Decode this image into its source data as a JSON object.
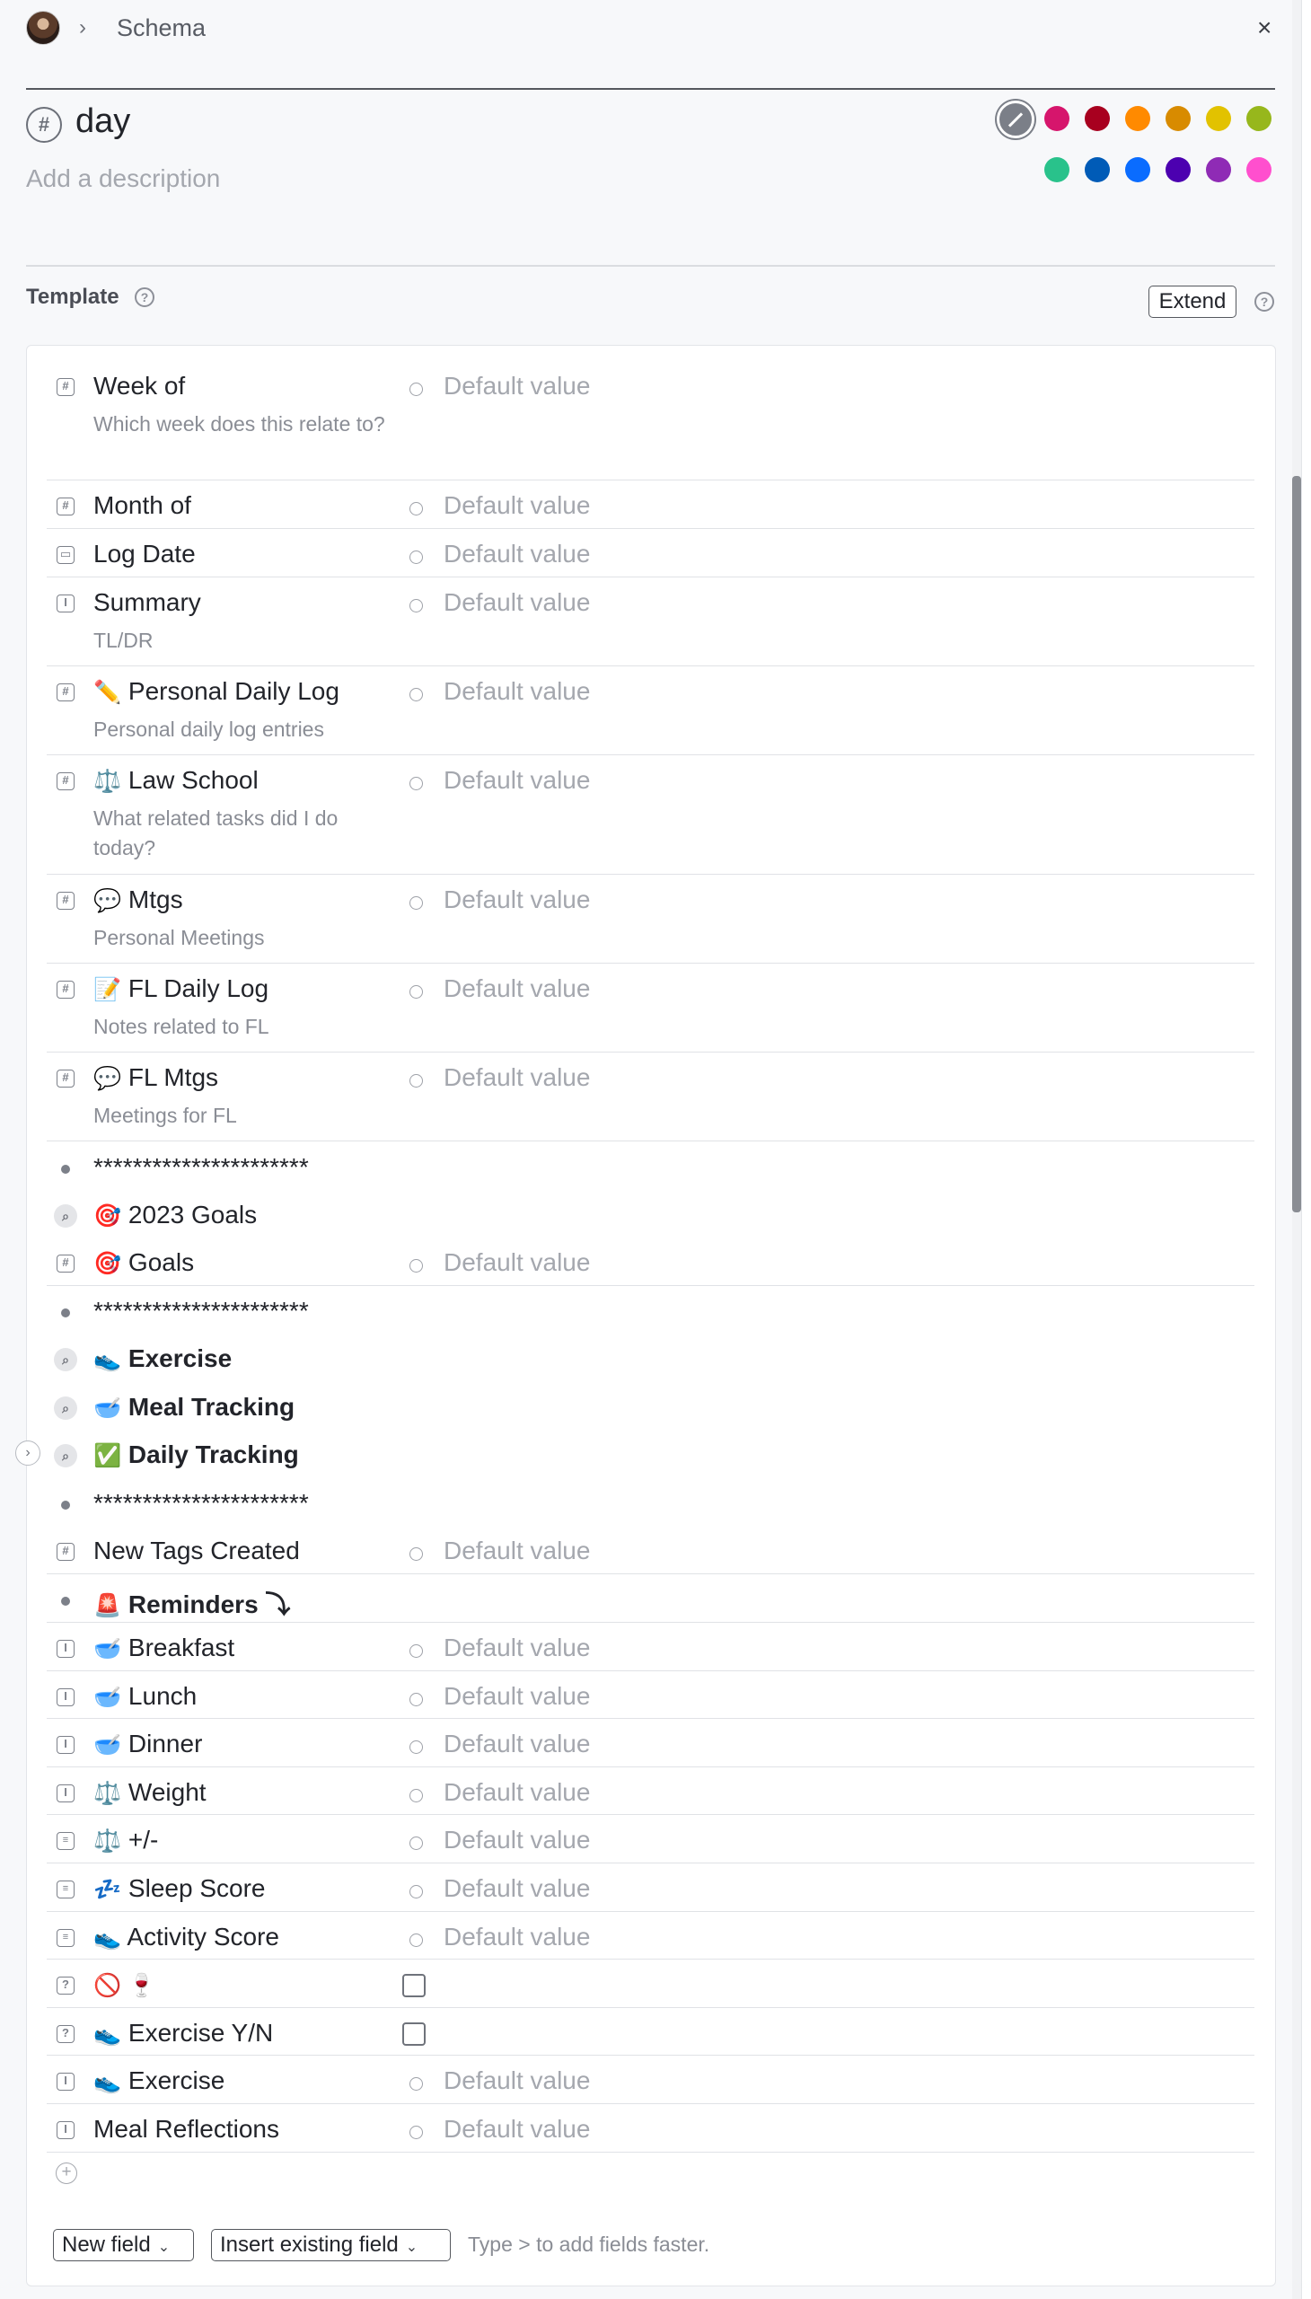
{
  "header": {
    "breadcrumb": "Schema",
    "close": "×"
  },
  "title": {
    "hash": "#",
    "name": "day",
    "description_placeholder": "Add a description"
  },
  "colors": [
    "#d6156c",
    "#a8001f",
    "#ff8a00",
    "#d88b00",
    "#e2c200",
    "#97b71c",
    "#29c28b",
    "#005bb7",
    "#0a6cff",
    "#4c00b0",
    "#8f2bb5",
    "#ff4fce"
  ],
  "template": {
    "label": "Template",
    "extend": "Extend"
  },
  "fields": [
    {
      "icon": "#",
      "name": "Week of",
      "desc": "Which week does this relate to?",
      "value": "Default value"
    },
    {
      "icon": "#",
      "name": "Month of",
      "value": "Default value"
    },
    {
      "icon": "cal",
      "name": "Log Date",
      "value": "Default value"
    },
    {
      "icon": "I",
      "name": "Summary",
      "desc": "TL/DR",
      "value": "Default value"
    },
    {
      "icon": "#",
      "emoji": "✏️",
      "name": "Personal Daily Log",
      "desc": "Personal daily log entries",
      "value": "Default value"
    },
    {
      "icon": "#",
      "emoji": "⚖️",
      "name": "Law School",
      "desc": "What related tasks did I do today?",
      "value": "Default value"
    },
    {
      "icon": "#",
      "emoji": "💬",
      "name": "Mtgs",
      "desc": "Personal Meetings",
      "value": "Default value"
    },
    {
      "icon": "#",
      "emoji": "📝",
      "name": "FL Daily Log",
      "desc": "Notes related to FL",
      "value": "Default value"
    },
    {
      "icon": "#",
      "emoji": "💬",
      "name": "FL Mtgs",
      "desc": "Meetings for FL",
      "value": "Default value"
    },
    {
      "icon": "dot",
      "name": "**********************"
    },
    {
      "icon": "search",
      "emoji": "🎯",
      "name": "2023 Goals"
    },
    {
      "icon": "#",
      "emoji": "🎯",
      "name": "Goals",
      "value": "Default value"
    },
    {
      "icon": "dot",
      "name": "**********************"
    },
    {
      "icon": "search",
      "emoji": "👟",
      "name": "Exercise",
      "bold": true
    },
    {
      "icon": "search",
      "emoji": "🥣",
      "name": "Meal Tracking",
      "bold": true
    },
    {
      "icon": "search",
      "emoji": "✅",
      "name": "Daily Tracking",
      "bold": true
    },
    {
      "icon": "dot",
      "name": "**********************"
    },
    {
      "icon": "#",
      "name": "New Tags Created",
      "value": "Default value"
    },
    {
      "icon": "dot",
      "emoji": "🚨",
      "name": "Reminders ⤵",
      "bold": true
    },
    {
      "icon": "I",
      "emoji": "🥣",
      "name": "Breakfast",
      "value": "Default value"
    },
    {
      "icon": "I",
      "emoji": "🥣",
      "name": "Lunch",
      "value": "Default value"
    },
    {
      "icon": "I",
      "emoji": "🥣",
      "name": "Dinner",
      "value": "Default value"
    },
    {
      "icon": "I",
      "emoji": "⚖️",
      "name": "Weight",
      "value": "Default value"
    },
    {
      "icon": "list",
      "emoji": "⚖️",
      "name": "+/-",
      "value": "Default value"
    },
    {
      "icon": "list",
      "emoji": "💤",
      "name": "Sleep Score",
      "value": "Default value"
    },
    {
      "icon": "list",
      "emoji": "👟",
      "name": "Activity Score",
      "value": "Default value"
    },
    {
      "icon": "?",
      "emoji": "🚫 🍷",
      "name": "",
      "checkbox": true
    },
    {
      "icon": "?",
      "emoji": "👟",
      "name": "Exercise Y/N",
      "checkbox": true
    },
    {
      "icon": "I",
      "emoji": "👟",
      "name": "Exercise",
      "value": "Default value"
    },
    {
      "icon": "I",
      "name": "Meal Reflections",
      "value": "Default value"
    }
  ],
  "footer": {
    "new_field": "New field",
    "insert_existing": "Insert existing field",
    "hint": "Type > to add fields faster."
  }
}
